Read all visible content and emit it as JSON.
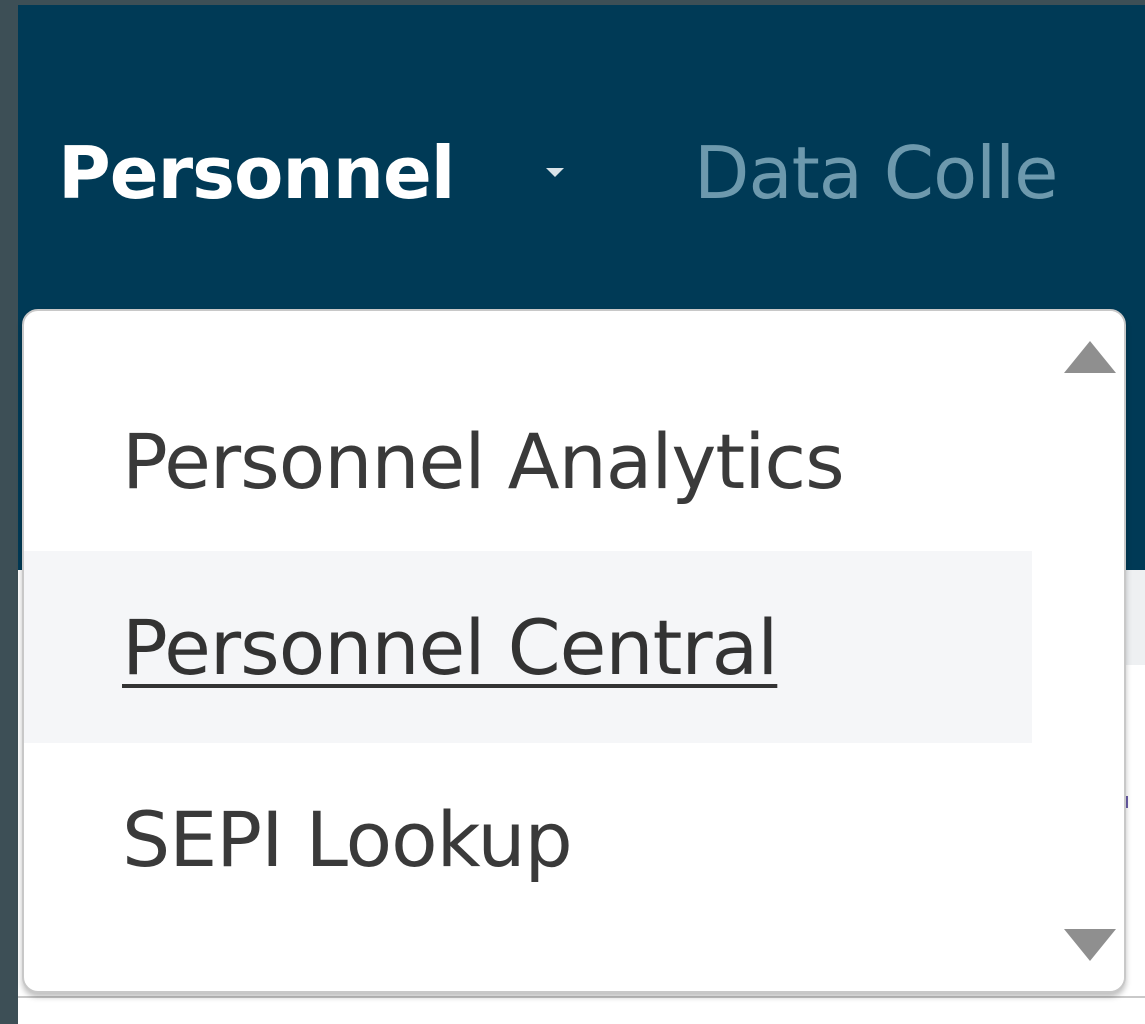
{
  "navbar": {
    "items": [
      {
        "label": "Personnel",
        "has_dropdown": true,
        "active": true
      },
      {
        "label": "Data Colle",
        "has_dropdown": false,
        "active": false
      }
    ],
    "background_color": "#003a56"
  },
  "dropdown": {
    "items": [
      {
        "label": "Personnel Analytics",
        "hovered": false
      },
      {
        "label": "Personnel Central",
        "hovered": true
      },
      {
        "label": "SEPI Lookup",
        "hovered": false
      }
    ],
    "scroll_up_icon": "triangle-up-icon",
    "scroll_down_icon": "triangle-down-icon"
  }
}
